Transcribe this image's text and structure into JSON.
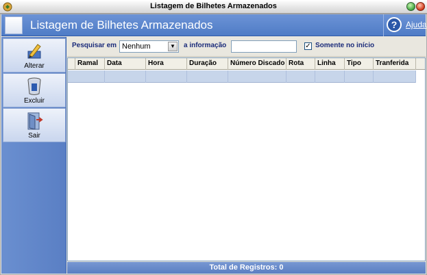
{
  "window": {
    "title": "Listagem de Bilhetes Armazenados"
  },
  "header": {
    "title": "Listagem de Bilhetes Armazenados",
    "help_label": "Ajuda"
  },
  "sidebar": {
    "items": [
      {
        "label": "Alterar",
        "icon": "edit-icon"
      },
      {
        "label": "Excluir",
        "icon": "trash-icon"
      },
      {
        "label": "Sair",
        "icon": "exit-door-icon"
      }
    ]
  },
  "search": {
    "field_label": "Pesquisar em",
    "field_value": "Nenhum",
    "info_label": "a informação",
    "info_value": "",
    "checkbox_label": "Somente no início",
    "checkbox_checked": true
  },
  "table": {
    "columns": [
      "Ramal",
      "Data",
      "Hora",
      "Duração",
      "Número Discado",
      "Rota",
      "Linha",
      "Tipo",
      "Tranferida"
    ],
    "rows": []
  },
  "footer": {
    "total_label": "Total de Registros: 0"
  },
  "colors": {
    "header_blue": "#4f7cc6",
    "sidebar_blue": "#5a7fc4",
    "selected_row": "#c7d5ea",
    "label_navy": "#1a2b7a"
  }
}
